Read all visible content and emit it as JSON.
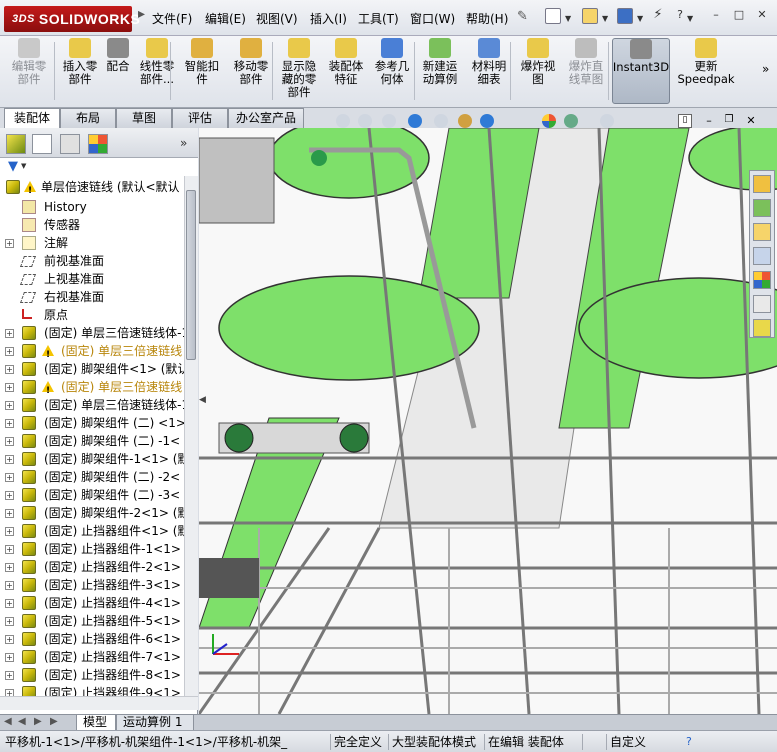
{
  "app": {
    "logo_prefix": "3DS",
    "logo_text": "SOLIDWORKS"
  },
  "menu": [
    "文件(F)",
    "编辑(E)",
    "视图(V)",
    "插入(I)",
    "工具(T)",
    "窗口(W)",
    "帮助(H)"
  ],
  "window_buttons": [
    "?",
    "–",
    "□"
  ],
  "ribbon": [
    {
      "label": "编辑零\n部件",
      "enabled": false
    },
    {
      "label": "插入零\n部件",
      "enabled": true
    },
    {
      "label": "配合",
      "enabled": true
    },
    {
      "label": "线性零\n部件...",
      "enabled": true
    },
    {
      "label": "智能扣\n件",
      "enabled": true
    },
    {
      "label": "移动零\n部件",
      "enabled": true
    },
    {
      "label": "显示隐\n藏的零\n部件",
      "enabled": true
    },
    {
      "label": "装配体\n特征",
      "enabled": true
    },
    {
      "label": "参考几\n何体",
      "enabled": true
    },
    {
      "label": "新建运\n动算例",
      "enabled": true
    },
    {
      "label": "材料明\n细表",
      "enabled": true
    },
    {
      "label": "爆炸视\n图",
      "enabled": true
    },
    {
      "label": "爆炸直\n线草图",
      "enabled": false
    },
    {
      "label": "Instant3D",
      "enabled": true,
      "active": true
    },
    {
      "label": "更新\nSpeedpak",
      "enabled": true
    }
  ],
  "tabs": [
    "装配体",
    "布局",
    "草图",
    "评估",
    "办公室产品"
  ],
  "active_tab": "装配体",
  "tree": {
    "root": "单层倍速链线 (默认<默认",
    "items": [
      {
        "label": "History",
        "icon": "history-icon",
        "expand": false,
        "indent": 1
      },
      {
        "label": "传感器",
        "icon": "sensor-icon",
        "expand": false,
        "indent": 1
      },
      {
        "label": "注解",
        "icon": "annotation-icon",
        "expand": true,
        "indent": 1
      },
      {
        "label": "前视基准面",
        "icon": "plane-icon",
        "expand": false,
        "indent": 1
      },
      {
        "label": "上视基准面",
        "icon": "plane-icon",
        "expand": false,
        "indent": 1
      },
      {
        "label": "右视基准面",
        "icon": "plane-icon",
        "expand": false,
        "indent": 1
      },
      {
        "label": "原点",
        "icon": "origin-icon",
        "expand": false,
        "indent": 1
      },
      {
        "label": "(固定) 单层三倍速链线体-1",
        "icon": "part-icon",
        "expand": true,
        "warn": false
      },
      {
        "label": "(固定) 单层三倍速链线",
        "icon": "part-icon",
        "expand": true,
        "warn": true
      },
      {
        "label": "(固定) 脚架组件<1> (默认",
        "icon": "part-icon",
        "expand": true,
        "warn": false
      },
      {
        "label": "(固定) 单层三倍速链线",
        "icon": "part-icon",
        "expand": true,
        "warn": true
      },
      {
        "label": "(固定) 单层三倍速链线体-1",
        "icon": "part-icon",
        "expand": true,
        "warn": false
      },
      {
        "label": "(固定) 脚架组件 (二) <1>",
        "icon": "part-icon",
        "expand": true,
        "warn": false
      },
      {
        "label": "(固定) 脚架组件 (二) -1<",
        "icon": "part-icon",
        "expand": true,
        "warn": false
      },
      {
        "label": "(固定) 脚架组件-1<1> (默认",
        "icon": "part-icon",
        "expand": true,
        "warn": false
      },
      {
        "label": "(固定) 脚架组件 (二) -2<",
        "icon": "part-icon",
        "expand": true,
        "warn": false
      },
      {
        "label": "(固定) 脚架组件 (二) -3<",
        "icon": "part-icon",
        "expand": true,
        "warn": false
      },
      {
        "label": "(固定) 脚架组件-2<1> (默认",
        "icon": "part-icon",
        "expand": true,
        "warn": false
      },
      {
        "label": "(固定) 止挡器组件<1> (默认",
        "icon": "part-icon",
        "expand": true,
        "warn": false
      },
      {
        "label": "(固定) 止挡器组件-1<1> (默",
        "icon": "part-icon",
        "expand": true,
        "warn": false
      },
      {
        "label": "(固定) 止挡器组件-2<1> (默",
        "icon": "part-icon",
        "expand": true,
        "warn": false
      },
      {
        "label": "(固定) 止挡器组件-3<1> (默",
        "icon": "part-icon",
        "expand": true,
        "warn": false
      },
      {
        "label": "(固定) 止挡器组件-4<1> (默",
        "icon": "part-icon",
        "expand": true,
        "warn": false
      },
      {
        "label": "(固定) 止挡器组件-5<1> (默",
        "icon": "part-icon",
        "expand": true,
        "warn": false
      },
      {
        "label": "(固定) 止挡器组件-6<1> (默",
        "icon": "part-icon",
        "expand": true,
        "warn": false
      },
      {
        "label": "(固定) 止挡器组件-7<1> (默",
        "icon": "part-icon",
        "expand": true,
        "warn": false
      },
      {
        "label": "(固定) 止挡器组件-8<1> (默",
        "icon": "part-icon",
        "expand": true,
        "warn": false
      },
      {
        "label": "(固定) 止挡器组件-9<1> (默",
        "icon": "part-icon",
        "expand": true,
        "warn": false
      }
    ]
  },
  "bottom_tabs": [
    "模型",
    "运动算例 1"
  ],
  "status": {
    "path": "平移机-1<1>/平移机-机架组件-1<1>/平移机-机架_",
    "definition": "完全定义",
    "mode": "大型装配体模式",
    "editing": "在编辑 装配体",
    "custom": "自定义"
  },
  "colors": {
    "plate_green": "#7ee06a",
    "frame": "#c8c8c8",
    "accent_red": "#c41a1a"
  }
}
